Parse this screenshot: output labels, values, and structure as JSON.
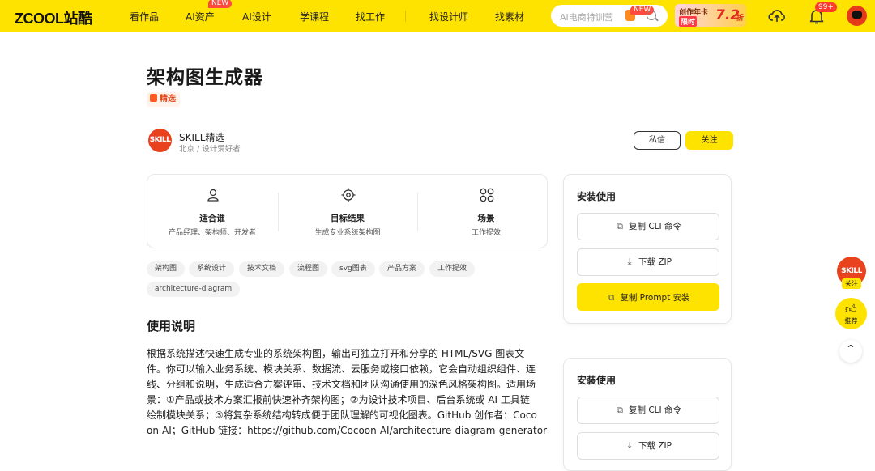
{
  "brand": {
    "logo": "ZCOOL站酷",
    "accent": "#ffe300"
  },
  "nav": {
    "items": [
      {
        "label": "看作品"
      },
      {
        "label": "AI资产",
        "badge": "NEW"
      },
      {
        "label": "AI设计"
      },
      {
        "label": "学课程"
      },
      {
        "label": "找工作"
      },
      {
        "label": "找设计师"
      },
      {
        "label": "找素材"
      }
    ]
  },
  "search": {
    "placeholder": "AI电商特训营",
    "badge": "NEW"
  },
  "promo": {
    "line1": "创作年卡",
    "line2": "限时",
    "discount": "7.2",
    "unit": "折"
  },
  "header": {
    "notification_count": "99+"
  },
  "page": {
    "title": "架构图生成器",
    "featured_label": "精选"
  },
  "author": {
    "avatar_text": "SKILL",
    "name": "SKILL精选",
    "subtitle": "北京 / 设计爱好者",
    "message_label": "私信",
    "follow_label": "关注"
  },
  "info": [
    {
      "title": "适合谁",
      "desc": "产品经理、架构师、开发者",
      "icon": "user-icon"
    },
    {
      "title": "目标结果",
      "desc": "生成专业系统架构图",
      "icon": "target-icon"
    },
    {
      "title": "场景",
      "desc": "工作提效",
      "icon": "grid-icon"
    }
  ],
  "tags": [
    "架构图",
    "系统设计",
    "技术文档",
    "流程图",
    "svg图表",
    "产品方案",
    "工作提效",
    "architecture-diagram"
  ],
  "usage": {
    "heading": "使用说明",
    "lines": [
      "根据系统描述快速生成专业的系统架构图，输出可独立打开和分享的 HTML/SVG 图表文",
      "件。你可以输入业务系统、模块关系、数据流、云服务或接口依赖，它会自动组织组件、连",
      "线、分组和说明，生成适合方案评审、技术文档和团队沟通使用的深色风格架构图。适用场",
      "景：①产品或技术方案汇报前快速补齐架构图；②为设计技术项目、后台系统或 AI 工具链",
      "绘制模块关系；③将复杂系统结构转成便于团队理解的可视化图表。GitHub 创作者：Coco",
      "on-AI；GitHub 链接：https://github.com/Cocoon-AI/architecture-diagram-generator"
    ]
  },
  "install": {
    "title": "安装使用",
    "copy_cli": "复制 CLI 命令",
    "download_zip": "下载 ZIP",
    "copy_prompt": "复制 Prompt 安装"
  },
  "floating": {
    "avatar_text": "SKILL",
    "follow": "关注",
    "recommend": "推荐",
    "top_icon": "^"
  }
}
